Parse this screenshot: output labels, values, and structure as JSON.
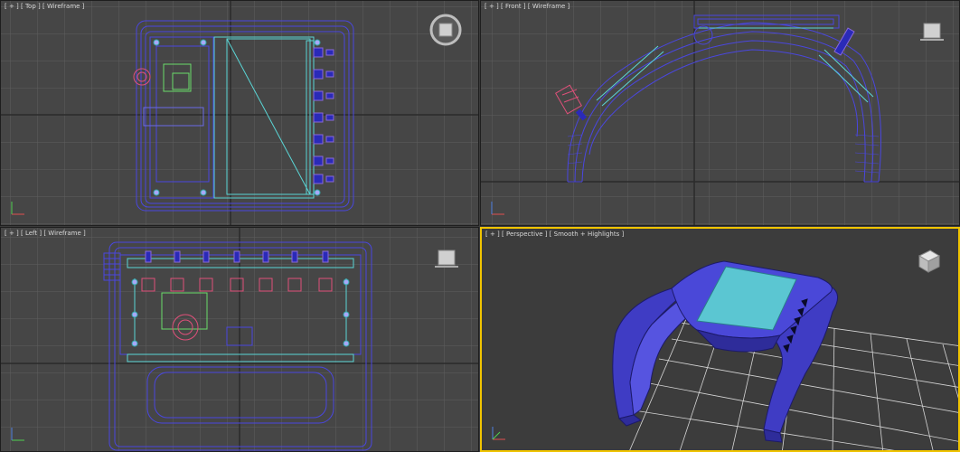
{
  "viewports": {
    "top": {
      "menu": "[ + ]",
      "view": "[ Top ]",
      "shading": "[ Wireframe ]"
    },
    "front": {
      "menu": "[ + ]",
      "view": "[ Front ]",
      "shading": "[ Wireframe ]"
    },
    "left": {
      "menu": "[ + ]",
      "view": "[ Left ]",
      "shading": "[ Wireframe ]"
    },
    "perspective": {
      "menu": "[ + ]",
      "view": "[ Perspective ]",
      "shading": "[ Smooth + Highlights ]"
    }
  },
  "colors": {
    "viewport_bg": "#464646",
    "perspective_bg": "#3c3c3c",
    "grid": "#5e5e5e",
    "grid_major": "#2a2a2a",
    "wire_blue": "#4a46e0",
    "wire_cyan": "#5ad6d6",
    "wire_green": "#6adc6a",
    "wire_pink": "#e0507a",
    "active_border": "#f0c400",
    "model_blue": "#4a48d8",
    "screen_cyan": "#5bc6d2"
  },
  "icons": [
    "viewcube-icon",
    "axis-tripod-icon",
    "steering-wheel-icon"
  ]
}
